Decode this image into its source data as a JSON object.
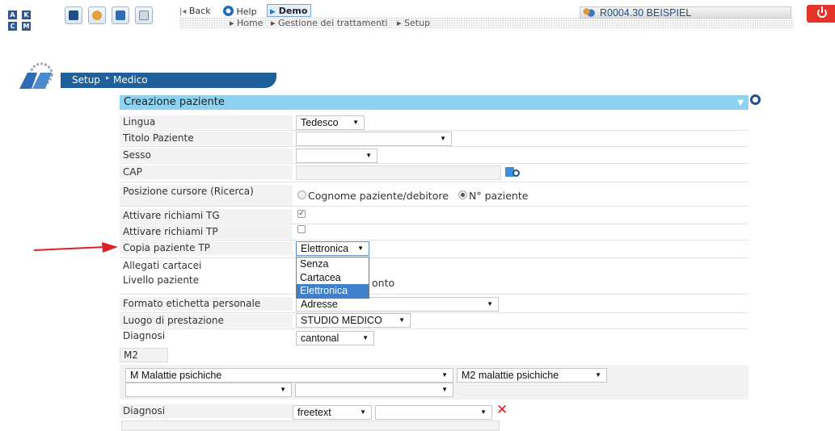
{
  "header": {
    "keys": [
      "A",
      "K",
      "C",
      "M"
    ],
    "back_label": "Back",
    "help_label": "Help",
    "demo_label": "Demo",
    "user_label": "R0004.30 BEISPIEL",
    "breadcrumbs": [
      "Home",
      "Gestione dei trattamenti",
      "Setup"
    ]
  },
  "subnav": {
    "items": [
      "Setup",
      "Medico"
    ]
  },
  "section": {
    "title": "Creazione paziente"
  },
  "form": {
    "lingua": {
      "label": "Lingua",
      "value": "Tedesco"
    },
    "titolo": {
      "label": "Titolo Paziente",
      "value": ""
    },
    "sesso": {
      "label": "Sesso",
      "value": ""
    },
    "cap": {
      "label": "CAP",
      "value": ""
    },
    "cursore": {
      "label": "Posizione cursore (Ricerca)",
      "option1": "Cognome paziente/debitore",
      "option2": "N° paziente",
      "selected": "N° paziente"
    },
    "richiami_tg": {
      "label": "Attivare richiami TG",
      "checked": true
    },
    "richiami_tp": {
      "label": "Attivare richiami TP",
      "checked": false
    },
    "copia_tp": {
      "label": "Copia paziente TP",
      "value": "Elettronica",
      "options": [
        "Senza",
        "Cartacea",
        "Elettronica"
      ]
    },
    "allegati": {
      "label": "Allegati cartacei"
    },
    "livello": {
      "label": "Livello paziente",
      "partial_text": "onto"
    },
    "formato": {
      "label": "Formato etichetta personale",
      "value": "Adresse"
    },
    "luogo": {
      "label": "Luogo di prestazione",
      "value": "STUDIO MEDICO"
    },
    "diagnosi1": {
      "label": "Diagnosi",
      "value": "cantonal",
      "code": "M2",
      "sel_a": "M Malattie psichiche",
      "sel_b": "M2 malattie psichiche",
      "sel_c": "",
      "sel_d": ""
    },
    "diagnosi2": {
      "label": "Diagnosi",
      "value": "freetext",
      "sel_b": ""
    }
  },
  "colors": {
    "section_bg": "#8dd3f0",
    "label_bg": "#f2f2f2",
    "power": "#e5332a",
    "arrow": "#e02020",
    "selection": "#3e80c9"
  }
}
